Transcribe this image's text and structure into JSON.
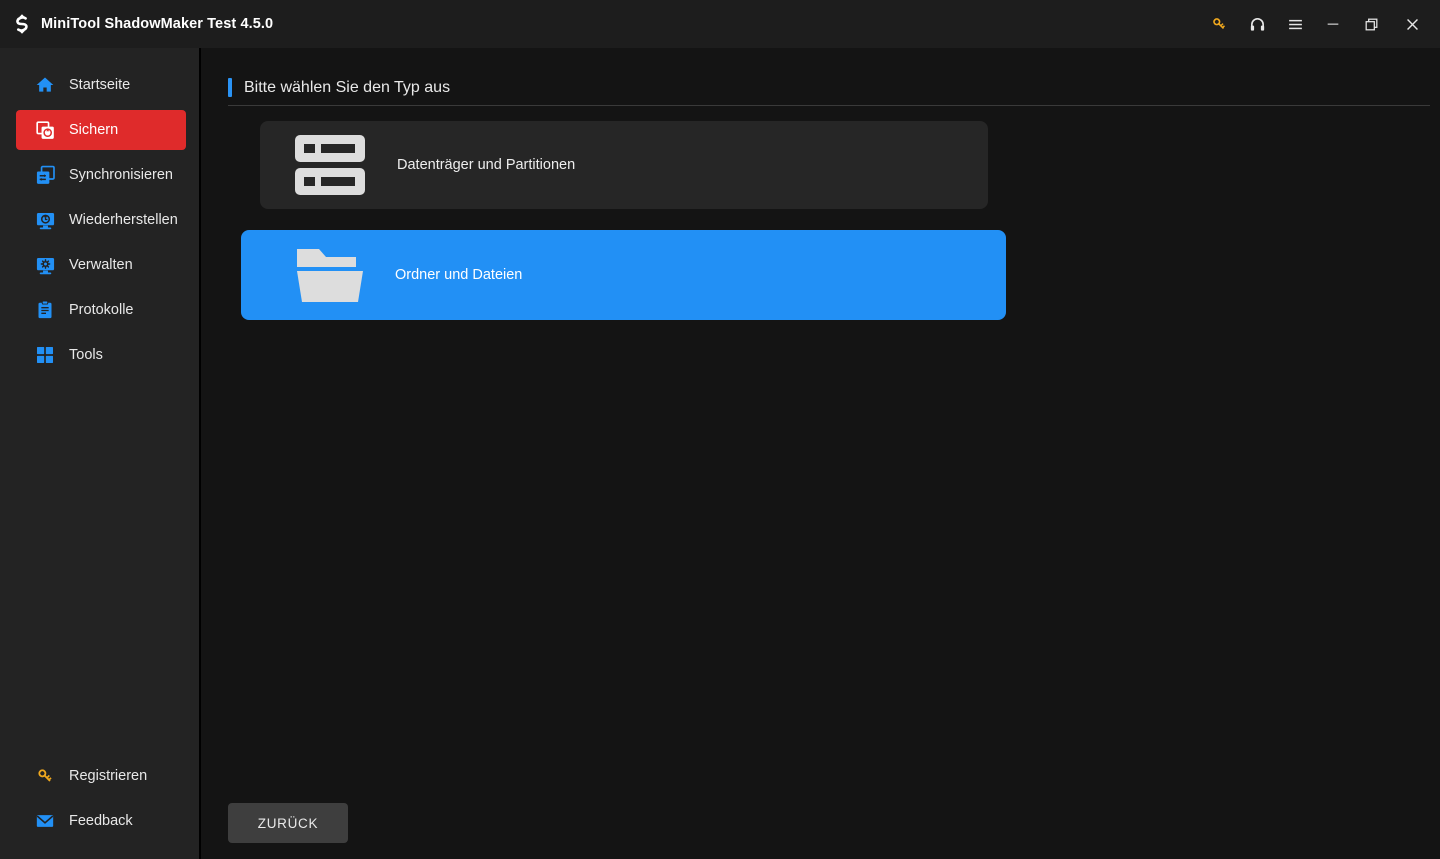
{
  "window": {
    "title": "MiniTool ShadowMaker Test 4.5.0",
    "logo_icon": "refresh-sync-logo-icon",
    "controls": [
      {
        "name": "register-key-icon",
        "label": "",
        "color": "#f0a81e"
      },
      {
        "name": "support-headset-icon",
        "label": "",
        "color": "#e6e6e6"
      },
      {
        "name": "menu-hamburger-icon",
        "label": "",
        "color": "#e6e6e6"
      },
      {
        "name": "minimize-icon",
        "label": "",
        "color": "#e6e6e6"
      },
      {
        "name": "restore-icon",
        "label": "",
        "color": "#e6e6e6"
      },
      {
        "name": "close-icon",
        "label": "",
        "color": "#e6e6e6"
      }
    ]
  },
  "sidebar": {
    "items": [
      {
        "label": "Startseite",
        "icon": "home-icon",
        "active": false
      },
      {
        "label": "Sichern",
        "icon": "backup-icon",
        "active": true
      },
      {
        "label": "Synchronisieren",
        "icon": "sync-icon",
        "active": false
      },
      {
        "label": "Wiederherstellen",
        "icon": "restore-monitor-icon",
        "active": false
      },
      {
        "label": "Verwalten",
        "icon": "manage-gear-monitor-icon",
        "active": false
      },
      {
        "label": "Protokolle",
        "icon": "logs-clipboard-icon",
        "active": false
      },
      {
        "label": "Tools",
        "icon": "tools-grid-icon",
        "active": false
      }
    ],
    "bottom_items": [
      {
        "label": "Registrieren",
        "icon": "key-icon"
      },
      {
        "label": "Feedback",
        "icon": "envelope-icon"
      }
    ]
  },
  "main": {
    "header_title": "Bitte wählen Sie den Typ aus",
    "cards": [
      {
        "label": "Datenträger und Partitionen",
        "icon": "disk-partitions-icon",
        "selected": false
      },
      {
        "label": "Ordner und Dateien",
        "icon": "folder-icon",
        "selected": true
      }
    ],
    "back_button_label": "ZURÜCK"
  },
  "colors": {
    "accent_blue": "#2290f5",
    "active_red": "#df2b2b",
    "sidebar_bg": "#232323",
    "main_bg": "#141414",
    "card_bg": "#262626",
    "titlebar_bg": "#1d1d1d",
    "key_yellow": "#f0a81e"
  }
}
